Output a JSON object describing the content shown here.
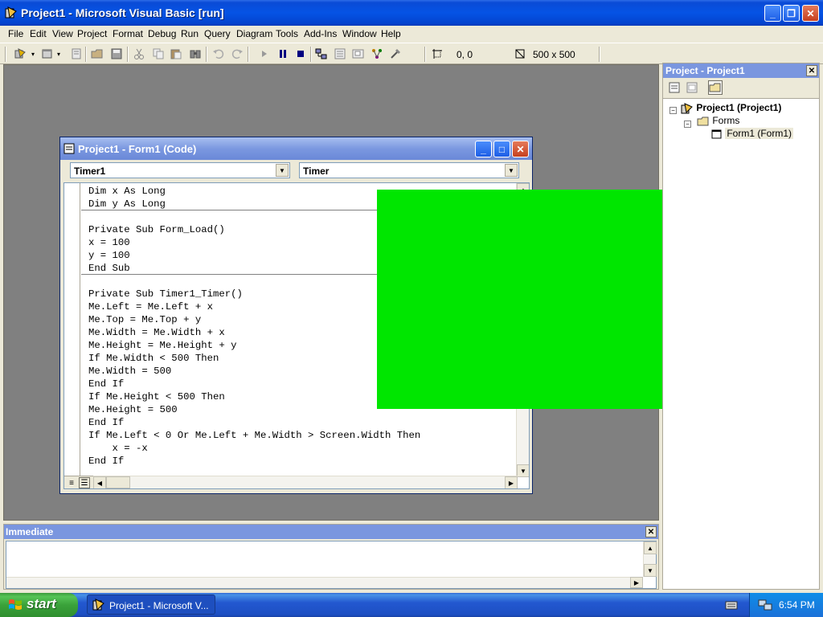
{
  "window": {
    "title": "Project1 - Microsoft Visual Basic [run]"
  },
  "menu": [
    "File",
    "Edit",
    "View",
    "Project",
    "Format",
    "Debug",
    "Run",
    "Query",
    "Diagram",
    "Tools",
    "Add-Ins",
    "Window",
    "Help"
  ],
  "toolbar": {
    "position": "0, 0",
    "size": "500 x 500"
  },
  "code_window": {
    "title": "Project1 - Form1 (Code)",
    "object_combo": "Timer1",
    "procedure_combo": "Timer",
    "lines": [
      "Dim x As Long",
      "Dim y As Long",
      "",
      "Private Sub Form_Load()",
      "x = 100",
      "y = 100",
      "End Sub",
      "",
      "Private Sub Timer1_Timer()",
      "Me.Left = Me.Left + x",
      "Me.Top = Me.Top + y",
      "Me.Width = Me.Width + x",
      "Me.Height = Me.Height + y",
      "If Me.Width < 500 Then",
      "Me.Width = 500",
      "End If",
      "If Me.Height < 500 Then",
      "Me.Height = 500",
      "End If",
      "If Me.Left < 0 Or Me.Left + Me.Width > Screen.Width Then",
      "    x = -x",
      "End If"
    ]
  },
  "running_form": {
    "color": "#00e600"
  },
  "project_panel": {
    "title": "Project - Project1",
    "tree": {
      "project": "Project1 (Project1)",
      "folder": "Forms",
      "form": "Form1 (Form1)"
    }
  },
  "immediate": {
    "title": "Immediate"
  },
  "taskbar": {
    "start": "start",
    "task": "Project1 - Microsoft V...",
    "clock": "6:54 PM"
  }
}
